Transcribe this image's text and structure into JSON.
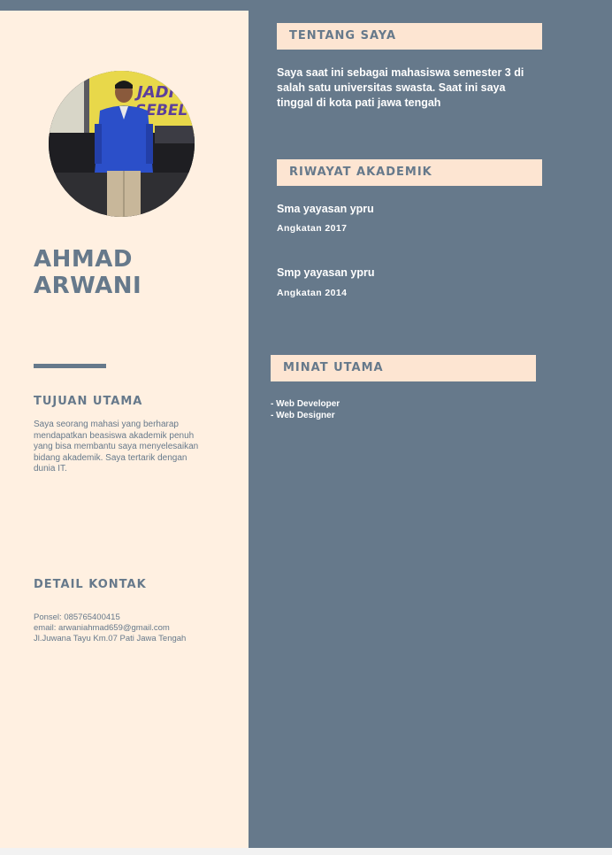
{
  "profile": {
    "first_name": "AHMAD",
    "last_name": "ARWANI"
  },
  "goal": {
    "heading": "TUJUAN UTAMA",
    "text": "Saya seorang mahasi yang berharap mendapatkan beasiswa akademik penuh yang bisa membantu saya menyelesaikan bidang akademik. Saya tertarik dengan dunia IT."
  },
  "contact": {
    "heading": "DETAIL KONTAK",
    "phone": "Ponsel: 085765400415",
    "email": "email: arwaniahmad659@gmail.com",
    "address": "Jl.Juwana Tayu Km.07 Pati Jawa Tengah"
  },
  "about": {
    "heading": "TENTANG SAYA",
    "text": "Saya saat ini sebagai mahasiswa semester  3 di salah satu universitas swasta. Saat ini saya tinggal di kota pati jawa tengah"
  },
  "academic": {
    "heading": "RIWAYAT AKADEMIK",
    "entries": [
      {
        "school": "Sma yayasan ypru",
        "year": "Angkatan 2017"
      },
      {
        "school": "Smp yayasan ypru",
        "year": "Angkatan 2014"
      }
    ]
  },
  "interests": {
    "heading": "MINAT UTAMA",
    "items": [
      "- Web Developer",
      "- Web Designer"
    ]
  },
  "photo_banner": {
    "line1": "JADI P",
    "line2": "SEBELUM"
  },
  "colors": {
    "slate": "#66798b",
    "cream": "#fff0e1",
    "peach": "#fde5d2"
  }
}
